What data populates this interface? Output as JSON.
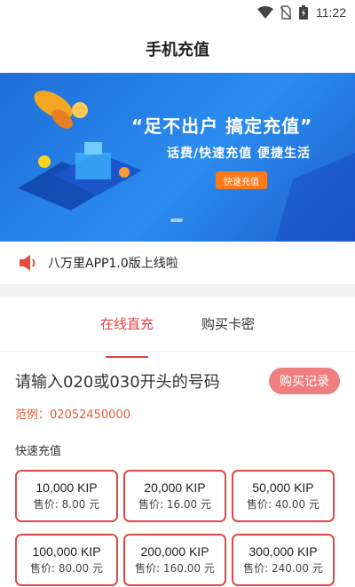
{
  "status_bar": {
    "time": "11:22",
    "icons": [
      "wifi-icon",
      "no-sim-icon",
      "battery-charging-icon"
    ]
  },
  "header": {
    "title": "手机充值"
  },
  "banner": {
    "slogan": "“足不出户 搞定充值”",
    "subtitle": "话费/快速充值 便捷生活",
    "button_label": "快速充值"
  },
  "notice": {
    "icon": "speaker-icon",
    "text": "八万里APP1.0版上线啦"
  },
  "tabs": [
    {
      "label": "在线直充",
      "active": true
    },
    {
      "label": "购买卡密",
      "active": false
    }
  ],
  "recharge": {
    "prompt": "请输入020或030开头的号码",
    "buy_record_label": "购买记录",
    "example": "范例：02052450000",
    "quick_title": "快速充值"
  },
  "packages": [
    {
      "amount": "10,000 KIP",
      "price": "售价: 8.00 元"
    },
    {
      "amount": "20,000 KIP",
      "price": "售价: 16.00 元"
    },
    {
      "amount": "50,000 KIP",
      "price": "售价: 40.00 元"
    },
    {
      "amount": "100,000 KIP",
      "price": "售价: 80.00 元"
    },
    {
      "amount": "200,000 KIP",
      "price": "售价: 160.00 元"
    },
    {
      "amount": "300,000 KIP",
      "price": "售价: 240.00 元"
    }
  ],
  "colors": {
    "accent": "#e04040",
    "banner_blue": "#2b8cf0",
    "button_orange": "#ff7a1a"
  }
}
